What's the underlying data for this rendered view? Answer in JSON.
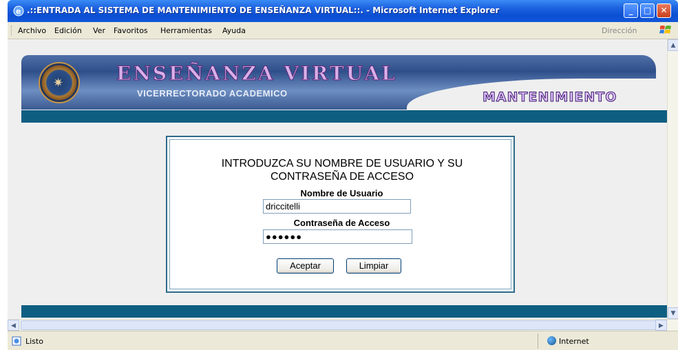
{
  "window": {
    "title": ".::ENTRADA AL SISTEMA DE MANTENIMIENTO DE ENSEÑANZA VIRTUAL::. - Microsoft Internet Explorer",
    "minimize": "_",
    "maximize": "□",
    "close": "✕"
  },
  "menu": {
    "items": [
      "Archivo",
      "Edición",
      "Ver",
      "Favoritos",
      "Herramientas",
      "Ayuda"
    ],
    "address_label": "Dirección"
  },
  "banner": {
    "title": "ENSEÑANZA VIRTUAL",
    "subtitle": "VICERRECTORADO ACADEMICO",
    "badge": "MANTENIMIENTO"
  },
  "login": {
    "prompt": "INTRODUZCA SU NOMBRE DE USUARIO Y SU CONTRASEÑA DE ACCESO",
    "username_label": "Nombre de Usuario",
    "username_value": "driccitelli",
    "password_label": "Contraseña de Acceso",
    "password_value": "●●●●●●",
    "accept_button": "Aceptar",
    "clear_button": "Limpiar"
  },
  "status": {
    "text": "Listo",
    "zone": "Internet"
  },
  "colors": {
    "titlebar": "#0b4fd3",
    "band": "#0e5e82",
    "page_bg": "#efefef"
  }
}
